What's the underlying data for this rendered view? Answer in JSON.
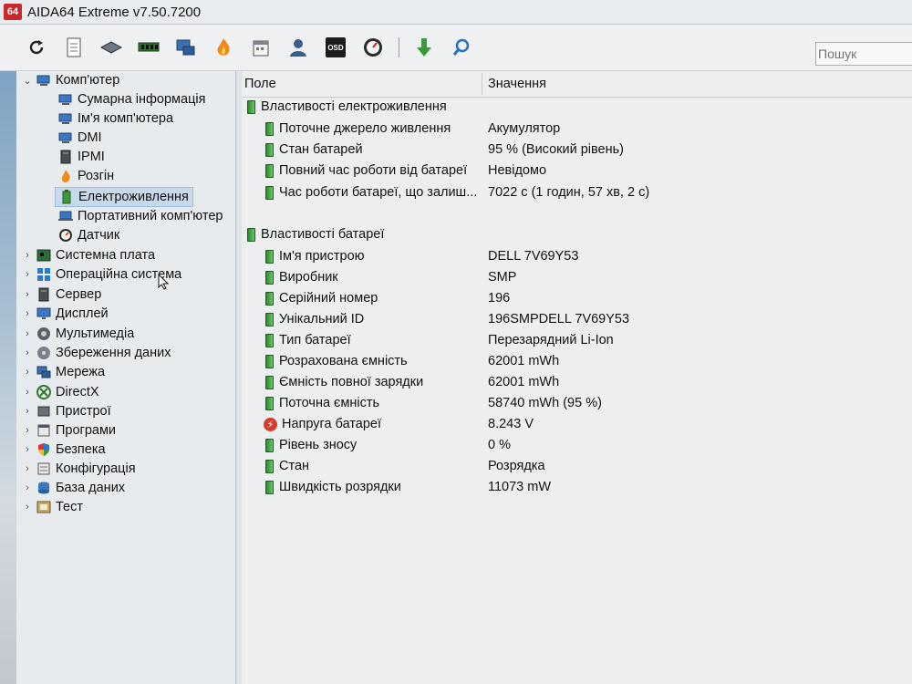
{
  "app": {
    "logo": "64",
    "title": "AIDA64 Extreme v7.50.7200"
  },
  "toolbar": {
    "buttons": [
      "refresh-icon",
      "report-icon",
      "motherboard-icon",
      "memory-icon",
      "network-icon",
      "flame-icon",
      "calendar-icon",
      "user-icon",
      "osd-icon",
      "gauge-icon",
      "download-icon",
      "search-icon"
    ],
    "osd_label": "OSD",
    "search_placeholder": "Пошук"
  },
  "tree": {
    "root": "Комп'ютер",
    "children": [
      "Сумарна інформація",
      "Ім'я комп'ютера",
      "DMI",
      "IPMI",
      "Розгін",
      "Електроживлення",
      "Портативний комп'ютер",
      "Датчик"
    ],
    "sections": [
      "Системна плата",
      "Операційна система",
      "Сервер",
      "Дисплей",
      "Мультимедіа",
      "Збереження даних",
      "Мережа",
      "DirectX",
      "Пристрої",
      "Програми",
      "Безпека",
      "Конфігурація",
      "База даних",
      "Тест"
    ]
  },
  "table": {
    "col_field": "Поле",
    "col_value": "Значення",
    "group1": "Властивості електроживлення",
    "power": [
      {
        "field": "Поточне джерело живлення",
        "value": "Акумулятор"
      },
      {
        "field": "Стан батарей",
        "value": "95 % (Високий рівень)"
      },
      {
        "field": "Повний час роботи від батареї",
        "value": "Невідомо"
      },
      {
        "field": "Час роботи батареї, що залиш...",
        "value": "7022 с (1 годин, 57 хв, 2 с)"
      }
    ],
    "group2": "Властивості батареї",
    "battery": [
      {
        "field": "Ім'я пристрою",
        "value": "DELL 7V69Y53"
      },
      {
        "field": "Виробник",
        "value": "SMP"
      },
      {
        "field": "Серійний номер",
        "value": "196"
      },
      {
        "field": "Унікальний ID",
        "value": "196SMPDELL 7V69Y53"
      },
      {
        "field": "Тип батареї",
        "value": "Перезарядний Li-Ion"
      },
      {
        "field": "Розрахована ємність",
        "value": "62001 mWh"
      },
      {
        "field": "Ємність повної зарядки",
        "value": "62001 mWh"
      },
      {
        "field": "Поточна ємність",
        "value": "58740 mWh  (95 %)"
      },
      {
        "field": "Напруга батареї",
        "value": "8.243 V"
      },
      {
        "field": "Рівень зносу",
        "value": "0 %"
      },
      {
        "field": "Стан",
        "value": "Розрядка"
      },
      {
        "field": "Швидкість розрядки",
        "value": "11073 mW"
      }
    ]
  }
}
